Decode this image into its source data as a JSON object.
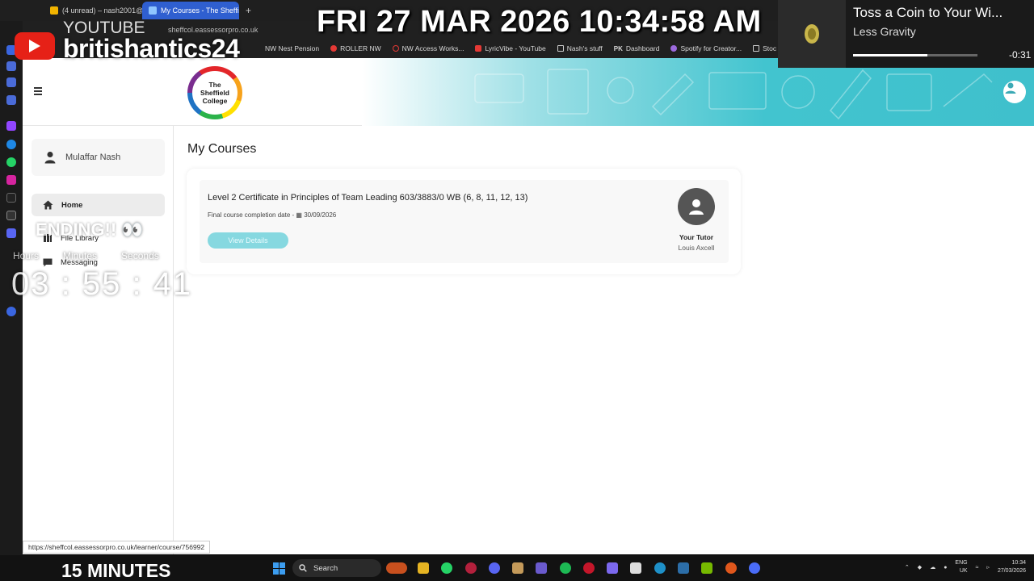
{
  "browser": {
    "tabs": [
      {
        "label": "(4 unread) – nash2001@...",
        "active": false
      },
      {
        "label": "My Courses - The Sheffiel",
        "active": true
      }
    ],
    "new_tab": "+",
    "address": "sheffcol.eassessorpro.co.uk",
    "bookmarks": [
      "NW Nest Pension",
      "ROLLER NW",
      "NW Access Works...",
      "LyricVibe - YouTube",
      "Nash's stuff",
      "Dashboard",
      "Spotify for Creator...",
      "Stoc"
    ]
  },
  "page": {
    "logo_lines": [
      "The",
      "Sheffield",
      "College"
    ],
    "user_name": "Mulaffar Nash",
    "nav": [
      {
        "label": "Home",
        "active": true
      },
      {
        "label": "File Library",
        "active": false
      },
      {
        "label": "Messaging",
        "active": false
      }
    ],
    "title": "My Courses",
    "course": {
      "title": "Level 2 Certificate in Principles of Team Leading 603/3883/0 WB (6, 8, 11, 12, 13)",
      "completion_label": "Final course completion date - ",
      "completion_date": "30/09/2026",
      "button": "View Details",
      "tutor_label": "Your Tutor",
      "tutor_name": "Louis Axcell"
    },
    "status_url": "https://sheffcol.eassessorpro.co.uk/learner/course/756992"
  },
  "overlay": {
    "yt_label": "YOUTUBE",
    "channel": "britishantics24",
    "datetime": "FRI 27 MAR 2026 10:34:58 AM",
    "now_playing": {
      "title": "Toss a Coin to Your Wi...",
      "artist": "Less Gravity",
      "time": "-0:31",
      "progress": 0.6
    },
    "ending": "ENDING!! 👀",
    "timer_labels": [
      "Hours",
      "Minutes",
      "Seconds"
    ],
    "timer": "03 : 55 : 41",
    "banner": "15 MINUTES"
  },
  "taskbar": {
    "search": "Search",
    "lang": [
      "ENG",
      "UK"
    ],
    "time": "10:34",
    "date": "27/03/2026"
  },
  "colors": {
    "accent": "#86d8e0",
    "banner": "#3fc0cc",
    "tab_active": "#2f5fd0",
    "yt_red": "#e62117"
  }
}
